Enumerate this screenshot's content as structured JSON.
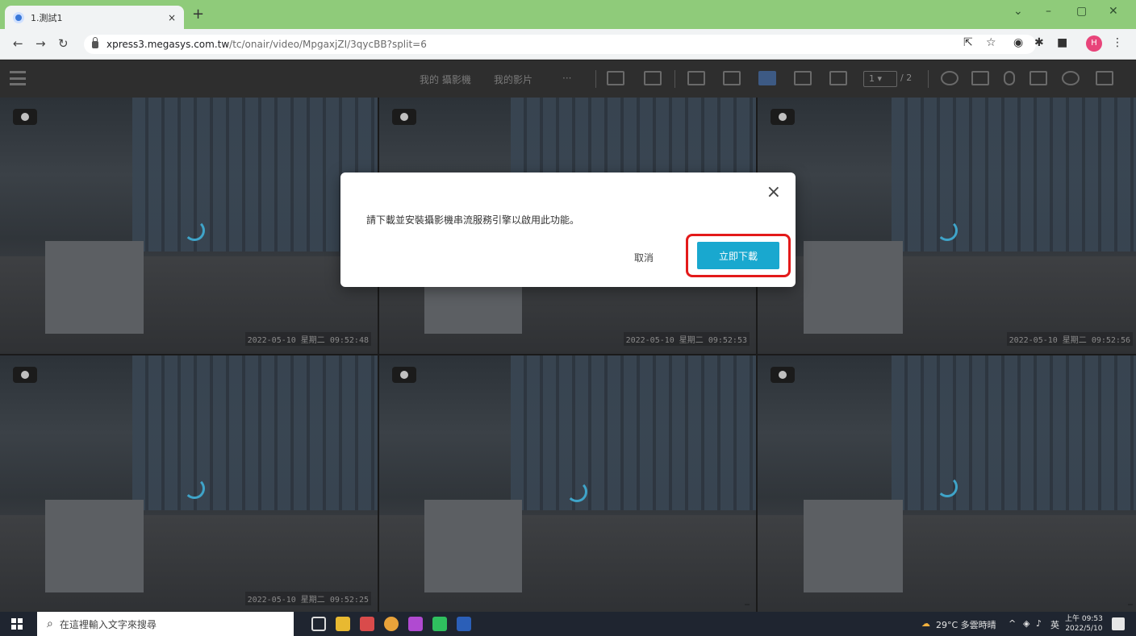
{
  "browser": {
    "tab_title": "1.測試1",
    "tab_close": "×",
    "new_tab": "+",
    "url_host": "xpress3.megasys.com.tw",
    "url_path": "/tc/onair/video/MpgaxjZI/3qycBB?split=6",
    "profile_initial": "H"
  },
  "toolbar": {
    "my_cameras": "我的 攝影機",
    "my_videos": "我的影片",
    "more": "···",
    "page_current": "1",
    "page_total": "/ 2"
  },
  "cameras": [
    {
      "timestamp": "2022-05-10 星期二 09:52:48"
    },
    {
      "timestamp": "2022-05-10 星期二 09:52:53"
    },
    {
      "timestamp": "2022-05-10 星期二 09:52:56"
    },
    {
      "timestamp": "2022-05-10 星期二 09:52:25"
    },
    {
      "timestamp": ""
    },
    {
      "timestamp": ""
    }
  ],
  "dialog": {
    "message": "請下載並安裝攝影機串流服務引擎以啟用此功能。",
    "cancel_label": "取消",
    "download_label": "立即下載",
    "close_glyph": "×"
  },
  "taskbar": {
    "search_placeholder": "在這裡輸入文字來搜尋",
    "weather": "29°C 多雲時晴",
    "ime": "英",
    "time": "上午 09:53",
    "date": "2022/5/10"
  },
  "colors": {
    "accent_button": "#19a8cf",
    "highlight_border": "#e31a1a",
    "tab_strip": "#8fcb7a"
  }
}
